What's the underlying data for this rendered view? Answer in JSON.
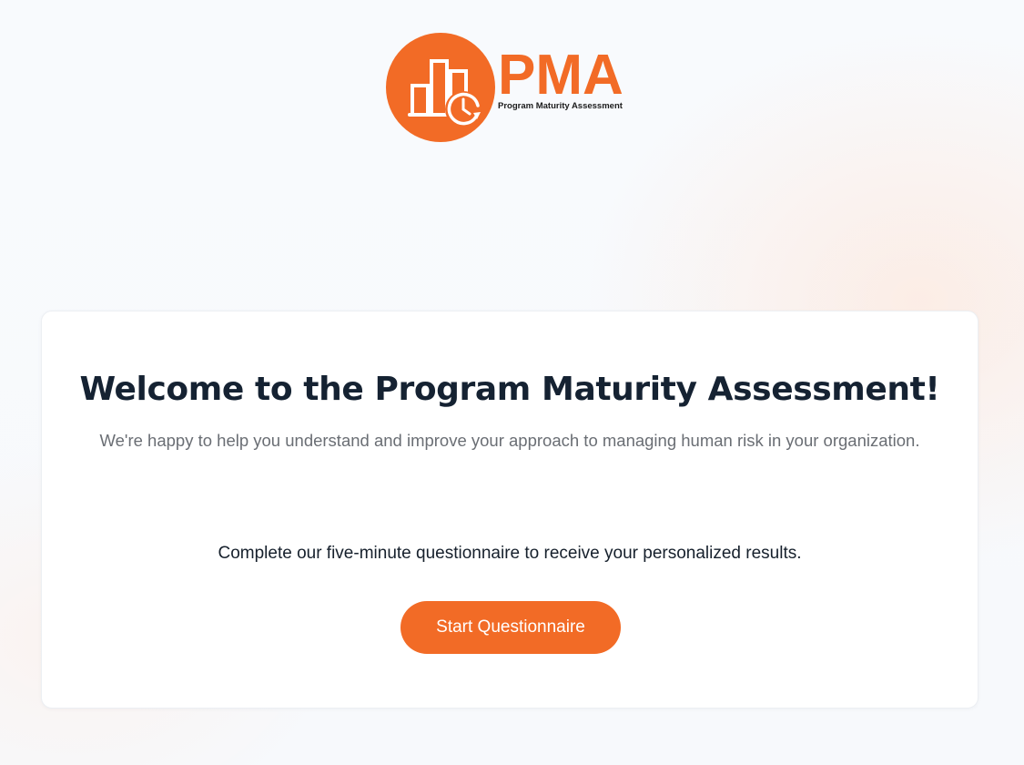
{
  "brand": {
    "wordmark": "PMA",
    "tagline": "Program Maturity Assessment",
    "accent_color": "#f26b26",
    "logo_icon": "bar-chart-clock-icon"
  },
  "welcome": {
    "title": "Welcome to the Program Maturity Assessment!",
    "subtitle": "We're happy to help you understand and improve your approach to managing human risk in your organization.",
    "prompt": "Complete our five-minute questionnaire to receive your personalized results.",
    "start_button_label": "Start Questionnaire"
  }
}
